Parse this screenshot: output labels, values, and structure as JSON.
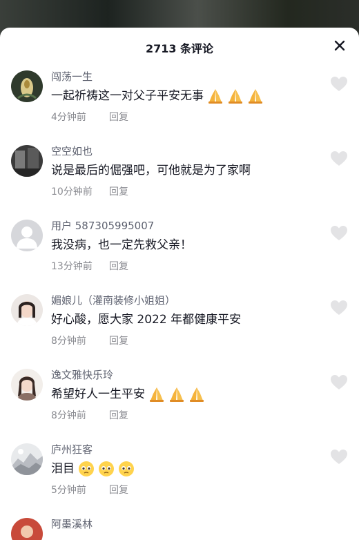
{
  "header": {
    "title": "2713 条评论"
  },
  "comments": [
    {
      "username": "闯荡一生",
      "text": "一起祈祷这一对父子平安无事",
      "emojis": [
        "folded-hands-emoji",
        "folded-hands-emoji",
        "folded-hands-emoji"
      ],
      "time": "4分钟前",
      "reply": "回复"
    },
    {
      "username": "空空如也",
      "text": "说是最后的倔强吧，可他就是为了家啊",
      "emojis": [],
      "time": "10分钟前",
      "reply": "回复"
    },
    {
      "username": "用户 587305995007",
      "text": "我没病，也一定先救父亲！",
      "emojis": [],
      "time": "13分钟前",
      "reply": "回复"
    },
    {
      "username": "媚娘儿（灌南装修小姐姐）",
      "text": "好心酸，愿大家 2022 年都健康平安",
      "emojis": [],
      "time": "8分钟前",
      "reply": "回复"
    },
    {
      "username": "逸文雅快乐玲",
      "text": "希望好人一生平安",
      "emojis": [
        "folded-hands-emoji",
        "folded-hands-emoji",
        "folded-hands-emoji"
      ],
      "time": "8分钟前",
      "reply": "回复"
    },
    {
      "username": "庐州狂客",
      "text": "泪目",
      "emojis": [
        "pleading-face-emoji",
        "pleading-face-emoji",
        "pleading-face-emoji"
      ],
      "time": "5分钟前",
      "reply": "回复"
    },
    {
      "username": "阿墨溪林",
      "text": "",
      "emojis": [],
      "time": "",
      "reply": ""
    }
  ],
  "colors": {
    "username": "#5e6270",
    "text": "#161823",
    "meta": "#8a8b91",
    "like_icon": "#e3e3e5"
  }
}
